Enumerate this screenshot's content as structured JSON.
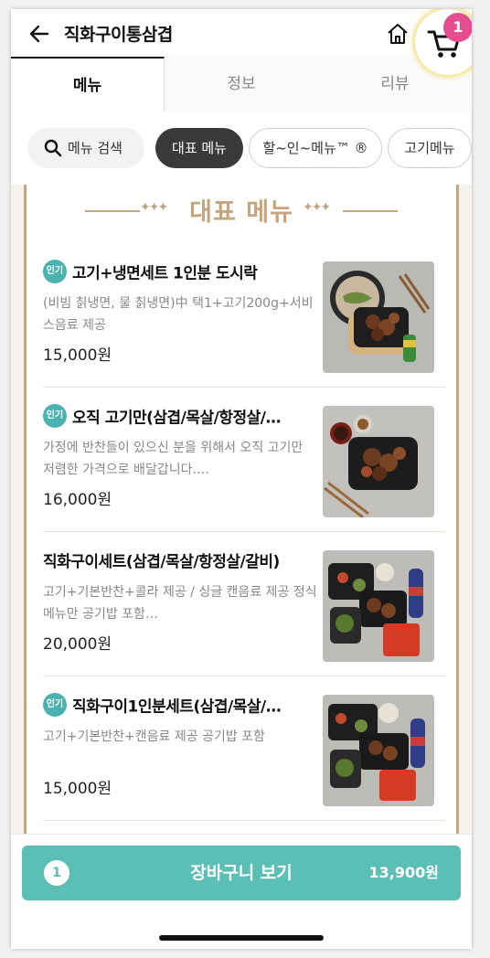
{
  "header": {
    "title": "직화구이통삼겹",
    "cart_badge": "1"
  },
  "tabs": [
    "메뉴",
    "정보",
    "리뷰"
  ],
  "chips": {
    "search": "메뉴 검색",
    "items": [
      "대표 메뉴",
      "할~인~메뉴™ ®",
      "고기메뉴"
    ]
  },
  "section": {
    "title": "대표 메뉴"
  },
  "menu_items": [
    {
      "badge": "인기",
      "name": "고기+냉면세트 1인분 도시락",
      "desc": "(비빔 칡냉면, 물 칡냉면)中 택1+고기200g+서비스음료 제공",
      "price": "15,000원"
    },
    {
      "badge": "인기",
      "name": "오직 고기만(삼겹/목살/항정살/…",
      "desc": "가정에 반찬들이 있으신 분을 위해서 오직 고기만 저렴한 가격으로 배달갑니다.…",
      "price": "16,000원"
    },
    {
      "badge": "",
      "name": "직화구이세트(삼겹/목살/항정살/갈비)",
      "desc": "고기+기본반찬+콜라 제공 / 싱글 캔음료 제공 정식메뉴만 공기밥 포함…",
      "price": "20,000원"
    },
    {
      "badge": "인기",
      "name": "직화구이1인분세트(삼겹/목살/…",
      "desc": "고기+기본반찬+캔음료 제공 공기밥 포함",
      "price": "15,000원"
    }
  ],
  "bottom_bar": {
    "count": "1",
    "label": "장바구니 보기",
    "total": "13,900원"
  },
  "colors": {
    "accent_teal": "#5bbfb6",
    "badge_pink": "#e54d8f",
    "gold": "#c4a57e"
  }
}
